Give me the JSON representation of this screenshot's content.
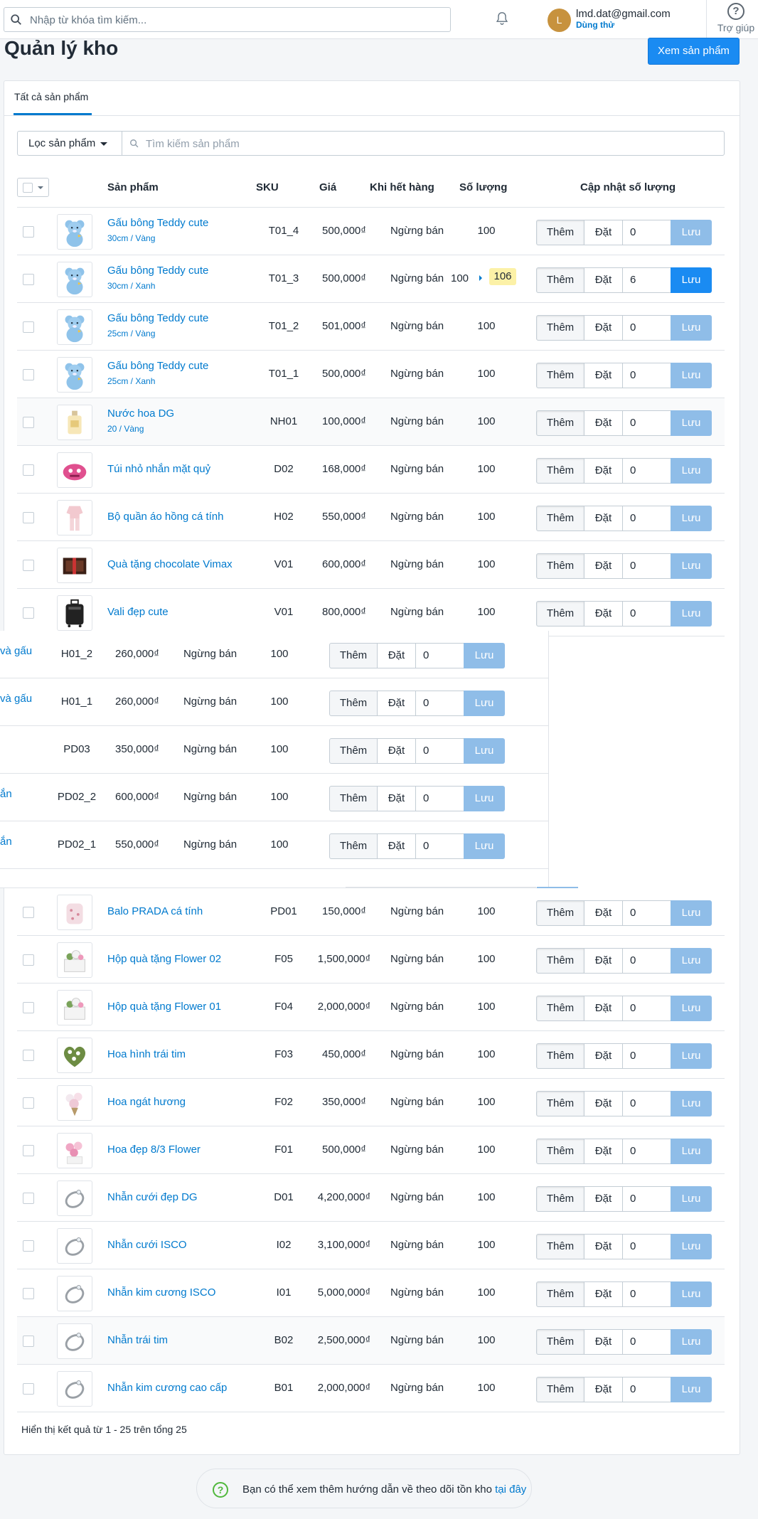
{
  "topbar": {
    "search_placeholder": "Nhập từ khóa tìm kiếm...",
    "avatar_letter": "L",
    "email": "lmd.dat@gmail.com",
    "plan": "Dùng thử",
    "help": "Trợ giúp"
  },
  "page": {
    "title": "Quản lý kho",
    "view_products": "Xem sản phẩm",
    "tab_all": "Tất cả sản phẩm",
    "filter_label": "Lọc sản phẩm",
    "product_search_placeholder": "Tìm kiếm sản phẩm"
  },
  "columns": {
    "product": "Sản phẩm",
    "sku": "SKU",
    "price": "Giá",
    "out_of_stock": "Khi hết hàng",
    "quantity": "Số lượng",
    "update_quantity": "Cập nhật số lượng"
  },
  "buttons": {
    "add": "Thêm",
    "set": "Đặt",
    "save": "Lưu"
  },
  "rows": [
    {
      "name": "Gấu bông Teddy cute",
      "variant": "30cm / Vàng",
      "sku": "T01_4",
      "price": "500,000₫",
      "oos": "Ngừng bán",
      "qty": "100",
      "input": "0",
      "thumb": "teddy-bear"
    },
    {
      "name": "Gấu bông Teddy cute",
      "variant": "30cm / Xanh",
      "sku": "T01_3",
      "price": "500,000₫",
      "oos": "Ngừng bán",
      "qty": "100",
      "new_qty": "106",
      "input": "6",
      "thumb": "teddy-bear",
      "active": true
    },
    {
      "name": "Gấu bông Teddy cute",
      "variant": "25cm / Vàng",
      "sku": "T01_2",
      "price": "501,000₫",
      "oos": "Ngừng bán",
      "qty": "100",
      "input": "0",
      "thumb": "teddy-bear"
    },
    {
      "name": "Gấu bông Teddy cute",
      "variant": "25cm / Xanh",
      "sku": "T01_1",
      "price": "500,000₫",
      "oos": "Ngừng bán",
      "qty": "100",
      "input": "0",
      "thumb": "teddy-bear"
    },
    {
      "name": "Nước hoa DG",
      "variant": "20 / Vàng",
      "sku": "NH01",
      "price": "100,000₫",
      "oos": "Ngừng bán",
      "qty": "100",
      "input": "0",
      "thumb": "perfume",
      "alt": true
    },
    {
      "name": "Túi nhỏ nhắn mặt quỷ",
      "sku": "D02",
      "price": "168,000₫",
      "oos": "Ngừng bán",
      "qty": "100",
      "input": "0",
      "thumb": "pink-bag"
    },
    {
      "name": "Bộ quần áo hồng cá tính",
      "sku": "H02",
      "price": "550,000₫",
      "oos": "Ngừng bán",
      "qty": "100",
      "input": "0",
      "thumb": "pink-outfit"
    },
    {
      "name": "Quà tặng chocolate Vimax",
      "sku": "V01",
      "price": "600,000₫",
      "oos": "Ngừng bán",
      "qty": "100",
      "input": "0",
      "thumb": "chocolate-box"
    },
    {
      "name": "Vali đẹp cute",
      "sku": "V01",
      "price": "800,000₫",
      "oos": "Ngừng bán",
      "qty": "100",
      "input": "0",
      "thumb": "suitcase"
    }
  ],
  "overlay_rows": [
    {
      "name_fragment": "và gấu",
      "sku": "H01_2",
      "price": "260,000₫",
      "oos": "Ngừng bán",
      "qty": "100",
      "input": "0"
    },
    {
      "name_fragment": "và gấu",
      "sku": "H01_1",
      "price": "260,000₫",
      "oos": "Ngừng bán",
      "qty": "100",
      "input": "0"
    },
    {
      "name_fragment": "",
      "sku": "PD03",
      "price": "350,000₫",
      "oos": "Ngừng bán",
      "qty": "100",
      "input": "0"
    },
    {
      "name_fragment": "ắn",
      "sku": "PD02_2",
      "price": "600,000₫",
      "oos": "Ngừng bán",
      "qty": "100",
      "input": "0"
    },
    {
      "name_fragment": "ắn",
      "sku": "PD02_1",
      "price": "550,000₫",
      "oos": "Ngừng bán",
      "qty": "100",
      "input": "0"
    }
  ],
  "rows_bottom": [
    {
      "name": "Balo PRADA cá tính",
      "sku": "PD01",
      "price": "150,000₫",
      "oos": "Ngừng bán",
      "qty": "100",
      "input": "0",
      "thumb": "backpack"
    },
    {
      "name": "Hộp quà tặng Flower 02",
      "sku": "F05",
      "price": "1,500,000₫",
      "oos": "Ngừng bán",
      "qty": "100",
      "input": "0",
      "thumb": "flower-box"
    },
    {
      "name": "Hộp quà tặng Flower 01",
      "sku": "F04",
      "price": "2,000,000₫",
      "oos": "Ngừng bán",
      "qty": "100",
      "input": "0",
      "thumb": "flower-box"
    },
    {
      "name": "Hoa hình trái tim",
      "sku": "F03",
      "price": "450,000₫",
      "oos": "Ngừng bán",
      "qty": "100",
      "input": "0",
      "thumb": "flower-heart"
    },
    {
      "name": "Hoa ngát hương",
      "sku": "F02",
      "price": "350,000₫",
      "oos": "Ngừng bán",
      "qty": "100",
      "input": "0",
      "thumb": "flower-bouquet"
    },
    {
      "name": "Hoa đẹp 8/3 Flower",
      "sku": "F01",
      "price": "500,000₫",
      "oos": "Ngừng bán",
      "qty": "100",
      "input": "0",
      "thumb": "flower-pink"
    },
    {
      "name": "Nhẫn cưới đẹp DG",
      "sku": "D01",
      "price": "4,200,000₫",
      "oos": "Ngừng bán",
      "qty": "100",
      "input": "0",
      "thumb": "ring"
    },
    {
      "name": "Nhẫn cưới ISCO",
      "sku": "I02",
      "price": "3,100,000₫",
      "oos": "Ngừng bán",
      "qty": "100",
      "input": "0",
      "thumb": "ring"
    },
    {
      "name": "Nhẫn kim cương ISCO",
      "sku": "I01",
      "price": "5,000,000₫",
      "oos": "Ngừng bán",
      "qty": "100",
      "input": "0",
      "thumb": "ring"
    },
    {
      "name": "Nhẫn trái tim",
      "sku": "B02",
      "price": "2,500,000₫",
      "oos": "Ngừng bán",
      "qty": "100",
      "input": "0",
      "thumb": "ring",
      "alt": true
    },
    {
      "name": "Nhẫn kim cương cao cấp",
      "sku": "B01",
      "price": "2,000,000₫",
      "oos": "Ngừng bán",
      "qty": "100",
      "input": "0",
      "thumb": "ring"
    }
  ],
  "footer": {
    "showing": "Hiển thị kết quả từ 1 - 25 trên tổng 25",
    "tip_text": "Bạn có thể xem thêm hướng dẫn về theo dõi tồn kho",
    "tip_link": "tại đây",
    "tip_icon": "?"
  }
}
